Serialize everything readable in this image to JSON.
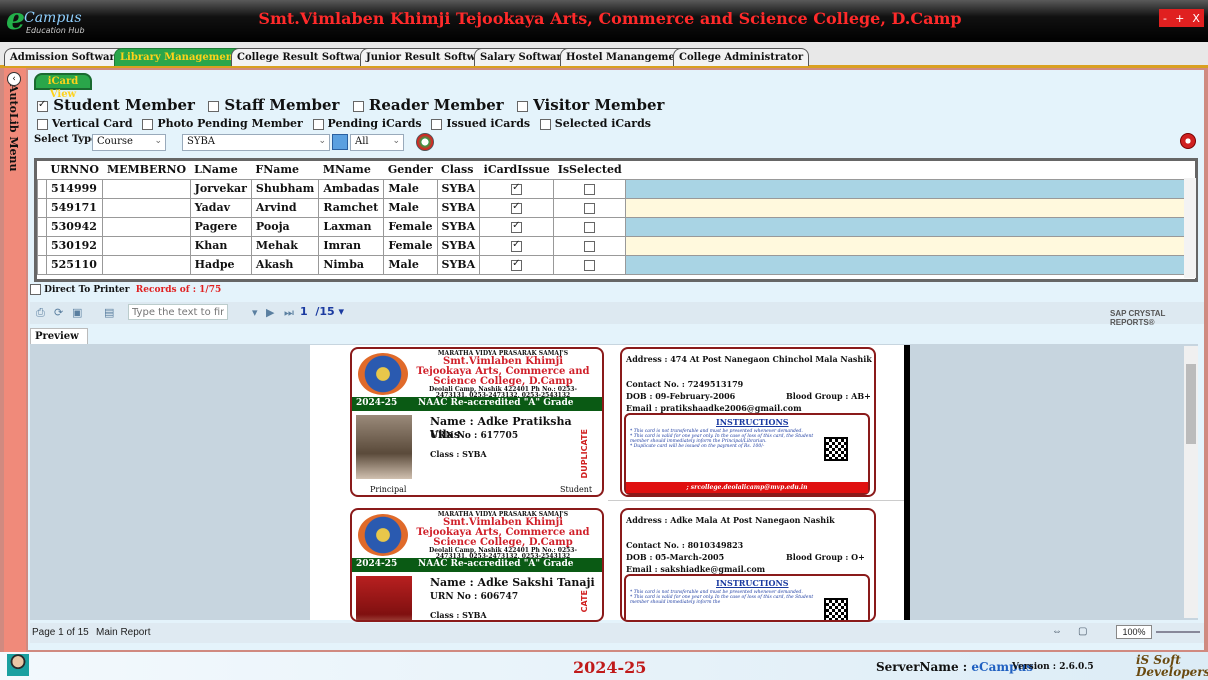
{
  "app": {
    "title": "Smt.Vimlaben Khimji Tejookaya Arts, Commerce and Science College, D.Camp",
    "logo_main": "e",
    "logo_sub": "Campus",
    "logo_tag": "Education Hub",
    "window_buttons": [
      "-",
      "+",
      "X"
    ]
  },
  "tabs": [
    {
      "label": "Admission Software",
      "active": false
    },
    {
      "label": "Library Managements",
      "active": true
    },
    {
      "label": "College Result Software",
      "active": false
    },
    {
      "label": "Junior Result Software",
      "active": false
    },
    {
      "label": "Salary Software",
      "active": false
    },
    {
      "label": "Hostel Manangement",
      "active": false
    },
    {
      "label": "College Administrator",
      "active": false
    }
  ],
  "sidebar": {
    "label": "AutoLib Menu"
  },
  "subtab": {
    "label": "iCard View"
  },
  "member_types": [
    {
      "label": "Student Member",
      "checked": true
    },
    {
      "label": "Staff Member",
      "checked": false
    },
    {
      "label": "Reader Member",
      "checked": false
    },
    {
      "label": "Visitor Member",
      "checked": false
    }
  ],
  "options": [
    {
      "label": "Vertical Card",
      "checked": false
    },
    {
      "label": "Photo Pending Member",
      "checked": false
    },
    {
      "label": "Pending iCards",
      "checked": false
    },
    {
      "label": "Issued iCards",
      "checked": false
    },
    {
      "label": "Selected iCards",
      "checked": false
    }
  ],
  "filters": {
    "select_type_label": "Select Type",
    "type_value": "Course",
    "course_value": "SYBA",
    "all_value": "All"
  },
  "grid": {
    "columns": [
      "URNNO",
      "MEMBERNO",
      "LName",
      "FName",
      "MName",
      "Gender",
      "Class",
      "iCardIssue",
      "IsSelected"
    ],
    "rows": [
      {
        "urnno": "514999",
        "memberno": "",
        "lname": "Jorvekar",
        "fname": "Shubham",
        "mname": "Ambadas",
        "gender": "Male",
        "class": "SYBA",
        "issue": true,
        "selected": false
      },
      {
        "urnno": "549171",
        "memberno": "",
        "lname": "Yadav",
        "fname": "Arvind",
        "mname": "Ramchet",
        "gender": "Male",
        "class": "SYBA",
        "issue": true,
        "selected": false
      },
      {
        "urnno": "530942",
        "memberno": "",
        "lname": "Pagere",
        "fname": "Pooja",
        "mname": "Laxman",
        "gender": "Female",
        "class": "SYBA",
        "issue": true,
        "selected": false
      },
      {
        "urnno": "530192",
        "memberno": "",
        "lname": "Khan",
        "fname": "Mehak",
        "mname": "Imran",
        "gender": "Female",
        "class": "SYBA",
        "issue": true,
        "selected": false
      },
      {
        "urnno": "525110",
        "memberno": "",
        "lname": "Hadpe",
        "fname": "Akash",
        "mname": "Nimba",
        "gender": "Male",
        "class": "SYBA",
        "issue": true,
        "selected": false
      }
    ]
  },
  "printer": {
    "label": "Direct To Printer",
    "records": "Records of : 1/75"
  },
  "report_toolbar": {
    "find_placeholder": "Type the text to find",
    "page_current": "1",
    "page_total": "/15",
    "brand": "SAP CRYSTAL REPORTS®"
  },
  "preview_tab": "Preview",
  "cards": [
    {
      "society": "MARATHA VIDYA PRASARAK SAMAJ'S",
      "college": "Smt.Vimlaben Khimji Tejookaya Arts, Commerce and Science College, D.Camp",
      "address": "Deolali Camp, Nashik 422401 Ph No.: 0253-2473131, 0253-2473132, 0253-2543132",
      "year": "2024-25",
      "naac": "NAAC Re-accredited \"A\" Grade",
      "name": "Name : Adke Pratiksha Vilas",
      "urn": "URN No : 617705",
      "class": "Class : SYBA",
      "duplicate": "DUPLICATE",
      "principal": "Principal",
      "student": "Student",
      "back": {
        "address": "Address : 474 At Post Nanegaon Chinchol Mala Nashik",
        "contact": "Contact No. : 7249513179",
        "dob": "DOB : 09-February-2006",
        "blood": "Blood Group : AB+",
        "email": "Email : pratikshaadke2006@gmail.com",
        "instructions_title": "INSTRUCTIONS",
        "instructions": [
          "This card is not transferable and must be presented whenever demanded.",
          "This card is valid for one year only. In the case of loss of this card, the Student member should immediately inform the Principal/Librarian.",
          "Duplicate card will be issued on the payment of Rs. 100/-"
        ],
        "footer": "; srcollege.deolalicamp@mvp.edu.in"
      }
    },
    {
      "society": "MARATHA VIDYA PRASARAK SAMAJ'S",
      "college": "Smt.Vimlaben Khimji Tejookaya Arts, Commerce and Science College, D.Camp",
      "address": "Deolali Camp, Nashik 422401 Ph No.: 0253-2473131, 0253-2473132, 0253-2543132",
      "year": "2024-25",
      "naac": "NAAC Re-accredited \"A\" Grade",
      "name": "Name : Adke Sakshi Tanaji",
      "urn": "URN No : 606747",
      "class": "Class : SYBA",
      "duplicate": "CATE",
      "back": {
        "address": "Address : Adke Mala At Post Nanegaon Nashik",
        "contact": "Contact No. : 8010349823",
        "dob": "DOB : 05-March-2005",
        "blood": "Blood Group : O+",
        "email": "Email : sakshiadke@gmail.com",
        "instructions_title": "INSTRUCTIONS",
        "instructions": [
          "This card is not transferable and must be presented whenever demanded.",
          "This card is valid for one year only. In the case of loss of this card, the Student member should immediately inform the"
        ]
      }
    }
  ],
  "statusbar": {
    "page": "Page 1 of 15",
    "report": "Main Report",
    "zoom": "100%"
  },
  "footer": {
    "year": "2024-25",
    "server_label": "ServerName : ",
    "server_value": "eCampus",
    "version": "Version : 2.6.0.5",
    "brand": "iS Soft Developers"
  }
}
